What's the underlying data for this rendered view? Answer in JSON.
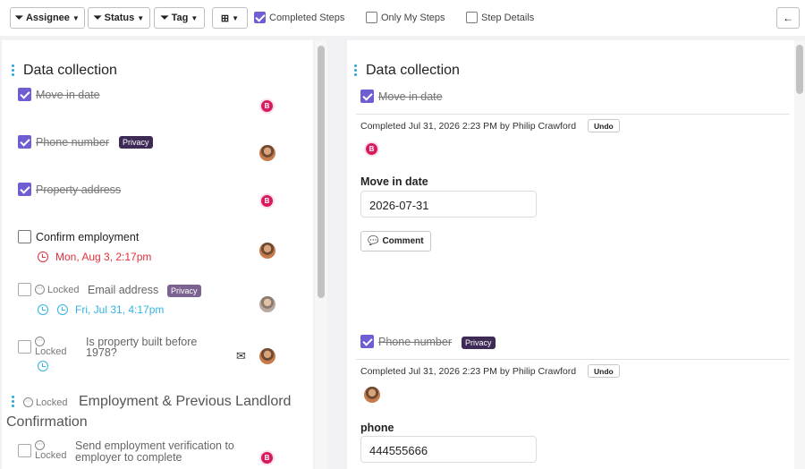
{
  "toolbar": {
    "assignee_label": "Assignee",
    "status_label": "Status",
    "tag_label": "Tag",
    "completed_steps_label": "Completed Steps",
    "completed_steps_checked": true,
    "only_my_steps_label": "Only My Steps",
    "only_my_steps_checked": false,
    "step_details_label": "Step Details",
    "step_details_checked": false,
    "back_glyph": "←"
  },
  "left": {
    "section_title": "Data collection",
    "steps": [
      {
        "label": "Move in date",
        "checked": true,
        "avatar": "B"
      },
      {
        "label": "Phone number",
        "checked": true,
        "badge": "Privacy",
        "avatar": "photo"
      },
      {
        "label": "Property address",
        "checked": true,
        "avatar": "B"
      },
      {
        "label": "Confirm employment",
        "checked": false,
        "due": "Mon, Aug 3, 2:17pm",
        "avatar": "photo"
      },
      {
        "label": "Email address",
        "locked": "Locked",
        "badge": "Privacy",
        "due": "Fri, Jul 31, 4:17pm",
        "avatar": "photo-gray"
      },
      {
        "label_line1": "Is property built before",
        "label_line2": "1978?",
        "locked": "Locked",
        "avatar": "photo",
        "icon": "mail-gear-icon"
      }
    ],
    "group": {
      "locked": "Locked",
      "title_line1": "Employment & Previous Landlord",
      "title_line2": "Confirmation"
    },
    "group_step": {
      "locked": "Locked",
      "label_line1": "Send employment verification to",
      "label_line2": "employer to complete",
      "avatar": "B"
    }
  },
  "right": {
    "section_title": "Data collection",
    "details": [
      {
        "step_label": "Move in date",
        "completed_text": "Completed Jul 31, 2026 2:23 PM by Philip Crawford",
        "undo_label": "Undo",
        "avatar": "B",
        "field_label": "Move in date",
        "field_value": "2026-07-31",
        "comment_label": "Comment"
      },
      {
        "step_label": "Phone number",
        "badge": "Privacy",
        "completed_text": "Completed Jul 31, 2026 2:23 PM by Philip Crawford",
        "undo_label": "Undo",
        "avatar": "photo",
        "field_label": "phone",
        "field_value": "444555666"
      }
    ]
  },
  "colors": {
    "accent": "#6d5fd3",
    "privacy_badge": "#3d2a55",
    "overdue": "#e0303d",
    "upcoming": "#32b4e2",
    "avatar_b": "#d81b60"
  }
}
